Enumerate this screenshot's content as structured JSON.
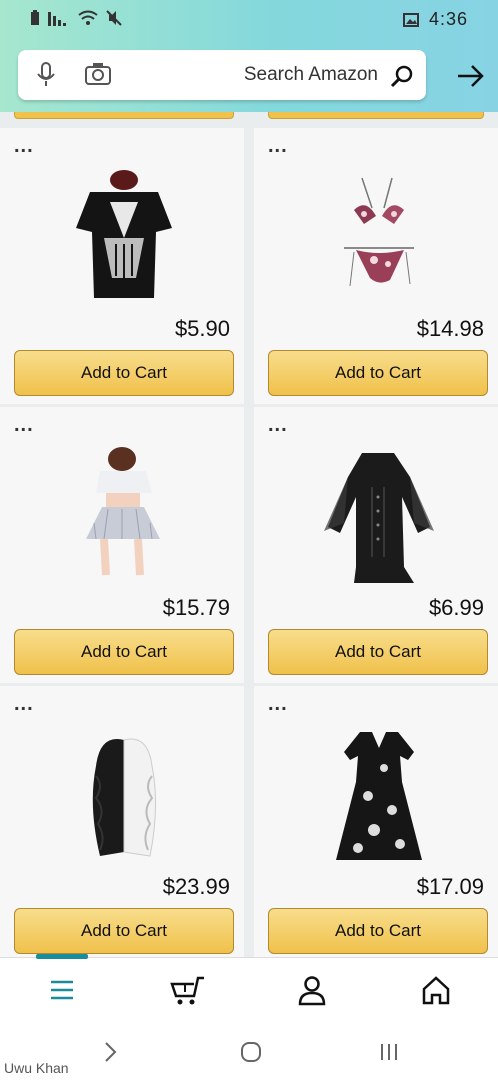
{
  "status": {
    "time": "4:36"
  },
  "search": {
    "placeholder": "Search Amazon"
  },
  "products": [
    {
      "name": "bikini",
      "price": "$14.98",
      "button": "Add to Cart"
    },
    {
      "name": "black-top",
      "price": "$5.90",
      "button": "Add to Cart"
    },
    {
      "name": "black-corset-dress",
      "price": "$6.99",
      "button": "Add to Cart"
    },
    {
      "name": "schoolgirl-outfit",
      "price": "$15.79",
      "button": "Add to Cart"
    },
    {
      "name": "printed-dress",
      "price": "$17.09",
      "button": "Add to Cart"
    },
    {
      "name": "black-white-wig",
      "price": "$23.99",
      "button": "Add to Cart"
    }
  ],
  "menu_dots": "...",
  "watermark": "Uwu Khan",
  "colors": {
    "button": "#f0c14b",
    "header": "#84d8dc",
    "accent": "#1a8c9a"
  }
}
